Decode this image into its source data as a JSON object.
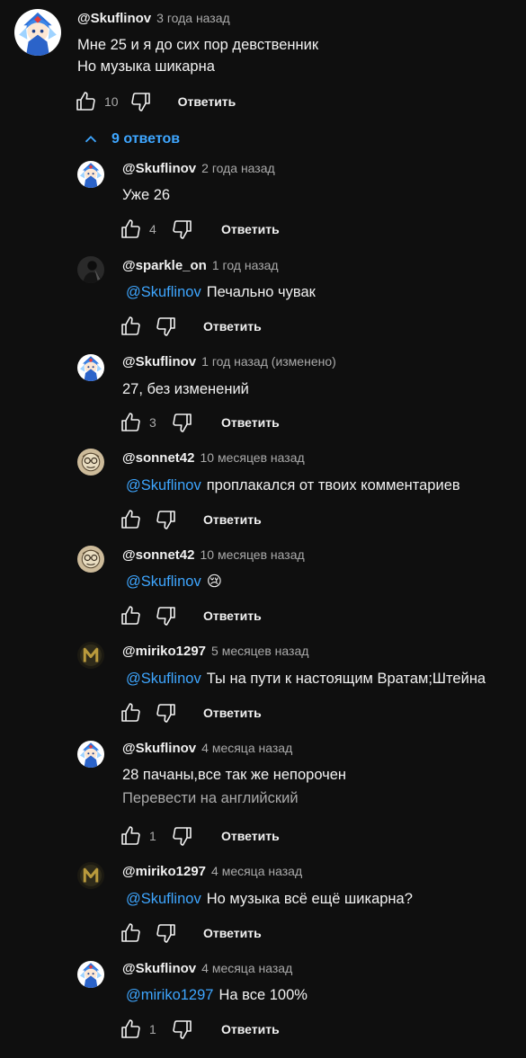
{
  "main_comment": {
    "author": "@Skuflinov",
    "time": "3 года назад",
    "lines": [
      "Мне 25 и я до сих пор девственник",
      "Но музыка шикарна"
    ],
    "likes": "10",
    "reply_label": "Ответить"
  },
  "replies_toggle": {
    "label": "9 ответов"
  },
  "replies": [
    {
      "author": "@Skuflinov",
      "time": "2 года назад",
      "mention": "",
      "text": "Уже 26",
      "likes": "4",
      "reply_label": "Ответить",
      "avatar": "cirno"
    },
    {
      "author": "@sparkle_on",
      "time": "1 год назад",
      "mention": "@Skuflinov",
      "text": "Печально чувак",
      "likes": "",
      "reply_label": "Ответить",
      "avatar": "dark"
    },
    {
      "author": "@Skuflinov",
      "time": "1 год назад (изменено)",
      "mention": "",
      "text": "27, без изменений",
      "likes": "3",
      "reply_label": "Ответить",
      "avatar": "cirno"
    },
    {
      "author": "@sonnet42",
      "time": "10 месяцев назад",
      "mention": "@Skuflinov",
      "text": "проплакался от твоих комментариев",
      "likes": "",
      "reply_label": "Ответить",
      "avatar": "sonnet"
    },
    {
      "author": "@sonnet42",
      "time": "10 месяцев назад",
      "mention": "@Skuflinov",
      "text": "😢",
      "likes": "",
      "reply_label": "Ответить",
      "avatar": "sonnet"
    },
    {
      "author": "@miriko1297",
      "time": "5 месяцев назад",
      "mention": "@Skuflinov",
      "text": "Ты на пути к настоящим Вратам;Штейна",
      "likes": "",
      "reply_label": "Ответить",
      "avatar": "miriko"
    },
    {
      "author": "@Skuflinov",
      "time": "4 месяца назад",
      "mention": "",
      "text": "28 пачаны,все так же непорочен",
      "translate": "Перевести на английский",
      "likes": "1",
      "reply_label": "Ответить",
      "avatar": "cirno"
    },
    {
      "author": "@miriko1297",
      "time": "4 месяца назад",
      "mention": "@Skuflinov",
      "text": "Но музыка всё ещё шикарна?",
      "likes": "",
      "reply_label": "Ответить",
      "avatar": "miriko"
    },
    {
      "author": "@Skuflinov",
      "time": "4 месяца назад",
      "mention": "@miriko1297",
      "text": "На все 100%",
      "likes": "1",
      "reply_label": "Ответить",
      "avatar": "cirno"
    }
  ],
  "colors": {
    "background": "#0f0f0f",
    "text": "#f1f1f1",
    "secondary": "#aaaaaa",
    "link": "#3ea6ff"
  }
}
